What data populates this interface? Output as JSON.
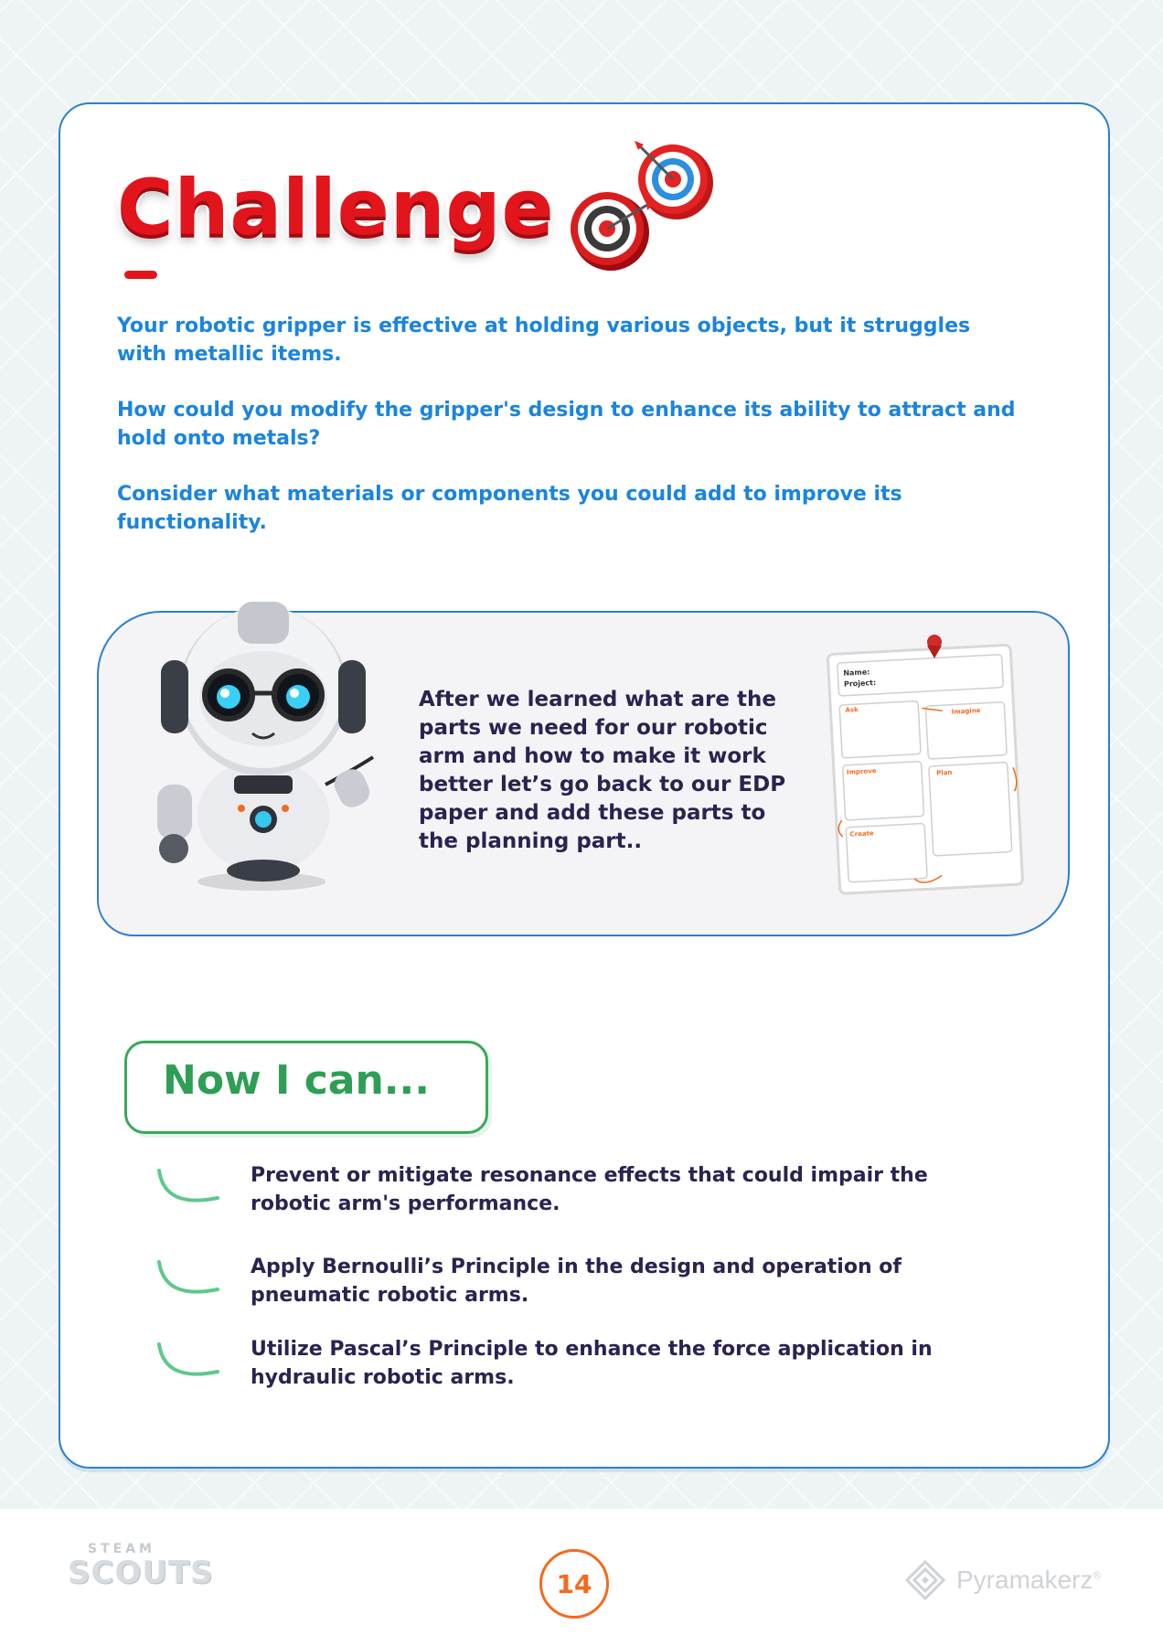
{
  "challenge": {
    "title": "Challenge",
    "paragraphs": [
      "Your robotic gripper is effective at holding various objects, but it struggles with metallic items.",
      "How could you modify the gripper's design to enhance its ability to attract and hold onto metals?",
      "Consider what materials or components you could add to improve its functionality."
    ],
    "icon": "target-with-darts-icon"
  },
  "info_box": {
    "text": "After we learned what are the parts we need for our robotic arm and how to make it work better let’s go back to our EDP paper and add these parts to the planning part..",
    "edp_sheet": {
      "name_label": "Name:",
      "project_label": "Project:",
      "steps": [
        "Ask",
        "Imagine",
        "Improve",
        "Plan",
        "Create"
      ]
    }
  },
  "now_i_can": {
    "title": "Now I can...",
    "items": [
      "Prevent or mitigate resonance effects that could impair the robotic arm's performance.",
      "Apply Bernoulli’s Principle in the design and operation of pneumatic robotic arms.",
      "Utilize Pascal’s Principle to enhance the force application in hydraulic robotic arms."
    ]
  },
  "footer": {
    "brand_top": "STEAM",
    "brand_bottom": "SCOUTS",
    "page_number": "14",
    "publisher": "Pyramakerz",
    "publisher_mark": "®"
  },
  "colors": {
    "title_red": "#e2141c",
    "text_blue": "#1a84e0",
    "text_navy": "#2a2350",
    "accent_green": "#2f9e55",
    "page_orange": "#f26b1d"
  }
}
